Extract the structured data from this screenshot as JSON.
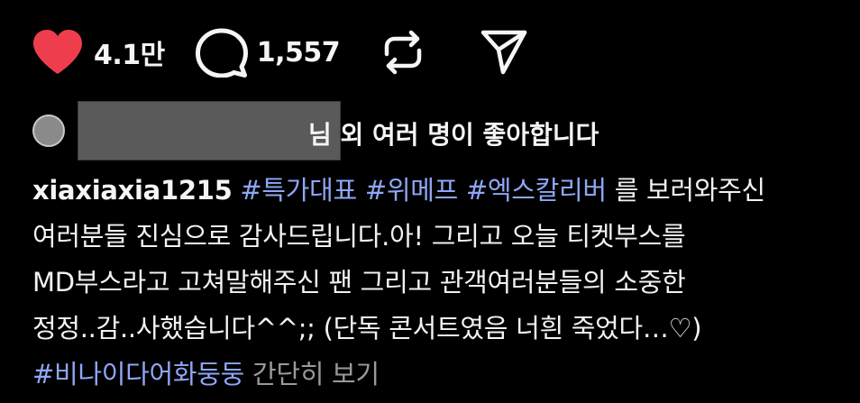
{
  "actions": {
    "like_count": "4.1만",
    "comment_count": "1,557"
  },
  "likes": {
    "text": "님 외 여러 명이 좋아합니다"
  },
  "caption": {
    "username": "xiaxiaxia1215",
    "tags_line1": [
      "#특가대표",
      "#위메프",
      "#엑스칼리버"
    ],
    "line1_rest": "를 보러와주신",
    "line2": "여러분들 진심으로 감사드립니다.아! 그리고 오늘 티켓부스를",
    "line3": "MD부스라고 고쳐말해주신 팬 그리고 관객여러분들의 소중한",
    "line4": "정정..감..사했습니다^^;; (단독 콘서트였음 너흰 죽었다…♡)",
    "tag_last": "#비나이다어화둥둥",
    "more_label": "간단히 보기"
  },
  "colors": {
    "background": "#000000",
    "heart": "#ee3e4d",
    "hashtag": "#8fa6f5",
    "muted": "#9a9a9a"
  }
}
